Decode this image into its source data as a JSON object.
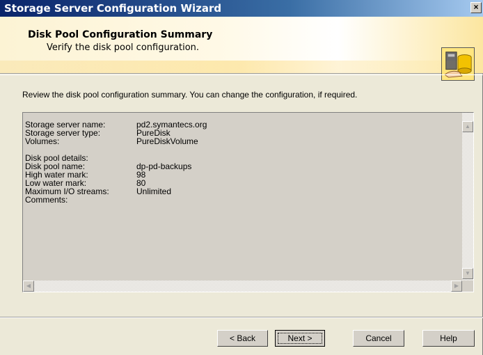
{
  "window": {
    "title": "Storage Server Configuration Wizard",
    "close_glyph": "×"
  },
  "header": {
    "title": "Disk Pool Configuration Summary",
    "subtitle": "Verify the disk pool configuration.",
    "icon": "storage-disk-pool-icon"
  },
  "intro": "Review the disk pool configuration summary. You can change the configuration, if required.",
  "summary": {
    "rows_top": [
      {
        "key": "Storage server name:",
        "value": "pd2.symantecs.org"
      },
      {
        "key": "Storage server type:",
        "value": "PureDisk"
      },
      {
        "key": "Volumes:",
        "value": "PureDiskVolume"
      }
    ],
    "section_label": "Disk pool details:",
    "rows_details": [
      {
        "key": "Disk pool name:",
        "value": "dp-pd-backups"
      },
      {
        "key": "High water mark:",
        "value": "98"
      },
      {
        "key": "Low water mark:",
        "value": "80"
      },
      {
        "key": "Maximum I/O streams:",
        "value": "Unlimited"
      },
      {
        "key": "Comments:",
        "value": ""
      }
    ]
  },
  "buttons": {
    "back": "< Back",
    "next": "Next >",
    "cancel": "Cancel",
    "help": "Help"
  },
  "colors": {
    "titlebar_start": "#0a246a",
    "titlebar_end": "#a6caf0",
    "dialog_bg": "#ece9d8"
  }
}
